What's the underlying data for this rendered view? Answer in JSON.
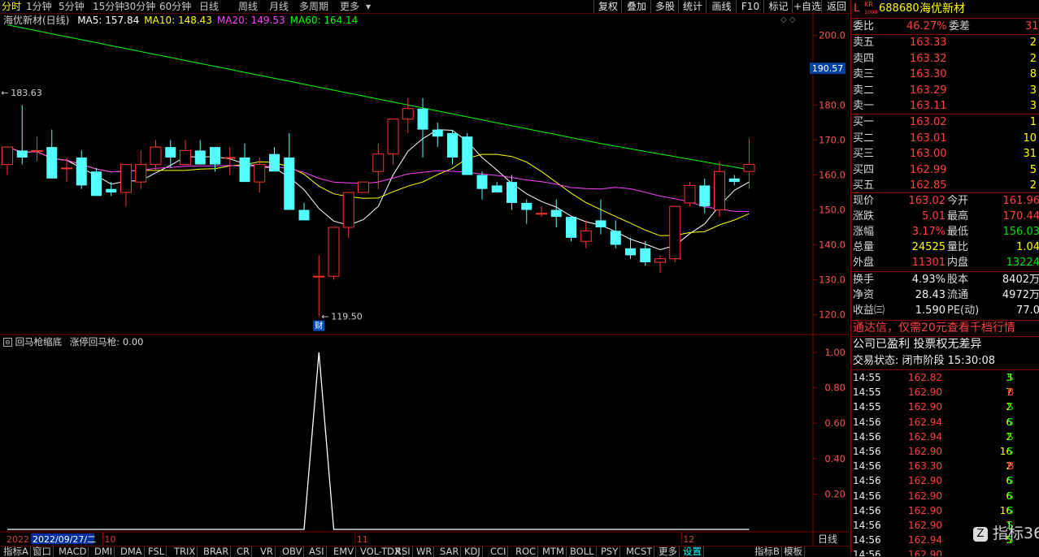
{
  "topbar": {
    "periods": [
      "分时",
      "1分钟",
      "5分钟",
      "15分钟",
      "30分钟",
      "60分钟",
      "日线",
      "周线",
      "月线",
      "多周期",
      "更多"
    ],
    "active_index": 0,
    "tools": [
      "复权",
      "叠加",
      "多股",
      "统计",
      "画线",
      "F10",
      "标记",
      "+自选",
      "返回"
    ]
  },
  "main": {
    "title": "海优新材(日线)",
    "ma_labels": [
      {
        "text": "MA5: 157.84",
        "color": "#ffffff"
      },
      {
        "text": "MA10: 148.43",
        "color": "#ffff00"
      },
      {
        "text": "MA20: 149.53",
        "color": "#ff40ff"
      },
      {
        "text": "MA60: 164.14",
        "color": "#00ff00"
      }
    ],
    "price_axis": [
      "200.0",
      "190.0",
      "180.0",
      "170.0",
      "160.0",
      "150.0",
      "140.0",
      "130.0",
      "120.0"
    ],
    "current_price_tag": "190.57",
    "high_marker": "183.63",
    "low_marker": "119.50",
    "fin_badge": "财"
  },
  "indicator": {
    "title": "回马枪缩底",
    "subtitle": "涨停回马枪: 0.00",
    "axis": [
      "1.00",
      "0.80",
      "0.60",
      "0.40",
      "0.20"
    ]
  },
  "xaxis": {
    "left_date": "2022",
    "cursor_date": "2022/09/27/二",
    "months": [
      "10",
      "11",
      "12"
    ],
    "right_label": "日线"
  },
  "chart_data": {
    "type": "candlestick",
    "ylim": [
      115,
      205
    ],
    "candles": [
      {
        "o": 163,
        "h": 167,
        "l": 160,
        "c": 168
      },
      {
        "o": 167,
        "h": 180,
        "l": 163,
        "c": 165
      },
      {
        "o": 167,
        "h": 171,
        "l": 164,
        "c": 167
      },
      {
        "o": 168,
        "h": 173,
        "l": 161,
        "c": 159
      },
      {
        "o": 162,
        "h": 165,
        "l": 158,
        "c": 162
      },
      {
        "o": 165,
        "h": 167,
        "l": 156,
        "c": 157
      },
      {
        "o": 161,
        "h": 162,
        "l": 155,
        "c": 154
      },
      {
        "o": 156,
        "h": 158,
        "l": 154,
        "c": 155
      },
      {
        "o": 155,
        "h": 162,
        "l": 151,
        "c": 163
      },
      {
        "o": 158,
        "h": 167,
        "l": 156,
        "c": 163
      },
      {
        "o": 163,
        "h": 170,
        "l": 161,
        "c": 168
      },
      {
        "o": 168,
        "h": 170,
        "l": 162,
        "c": 165
      },
      {
        "o": 163,
        "h": 170,
        "l": 163,
        "c": 167
      },
      {
        "o": 167,
        "h": 170,
        "l": 163,
        "c": 163
      },
      {
        "o": 168,
        "h": 168,
        "l": 161,
        "c": 163
      },
      {
        "o": 165,
        "h": 168,
        "l": 160,
        "c": 165
      },
      {
        "o": 165,
        "h": 169,
        "l": 158,
        "c": 158
      },
      {
        "o": 158,
        "h": 165,
        "l": 155,
        "c": 163
      },
      {
        "o": 166,
        "h": 168,
        "l": 161,
        "c": 161
      },
      {
        "o": 165,
        "h": 172,
        "l": 150,
        "c": 150
      },
      {
        "o": 150,
        "h": 152,
        "l": 147,
        "c": 147
      },
      {
        "o": 131,
        "h": 137,
        "l": 119.5,
        "c": 131
      },
      {
        "o": 131,
        "h": 145,
        "l": 130,
        "c": 145
      },
      {
        "o": 145,
        "h": 150,
        "l": 142,
        "c": 155
      },
      {
        "o": 155,
        "h": 158,
        "l": 155,
        "c": 158
      },
      {
        "o": 161,
        "h": 169,
        "l": 156,
        "c": 166
      },
      {
        "o": 166,
        "h": 173,
        "l": 163,
        "c": 176
      },
      {
        "o": 176,
        "h": 182,
        "l": 172,
        "c": 179
      },
      {
        "o": 179,
        "h": 182,
        "l": 165,
        "c": 173
      },
      {
        "o": 173,
        "h": 175,
        "l": 168,
        "c": 171
      },
      {
        "o": 172,
        "h": 173,
        "l": 163,
        "c": 165
      },
      {
        "o": 171,
        "h": 172,
        "l": 160,
        "c": 160
      },
      {
        "o": 160,
        "h": 161,
        "l": 153,
        "c": 156
      },
      {
        "o": 157,
        "h": 158,
        "l": 155,
        "c": 155
      },
      {
        "o": 158,
        "h": 160,
        "l": 150,
        "c": 152
      },
      {
        "o": 152,
        "h": 153,
        "l": 146,
        "c": 150
      },
      {
        "o": 149,
        "h": 151,
        "l": 148,
        "c": 149
      },
      {
        "o": 150,
        "h": 153,
        "l": 145,
        "c": 148
      },
      {
        "o": 148,
        "h": 148,
        "l": 141,
        "c": 142
      },
      {
        "o": 141,
        "h": 147,
        "l": 139,
        "c": 144
      },
      {
        "o": 147,
        "h": 153,
        "l": 143,
        "c": 145
      },
      {
        "o": 144,
        "h": 147,
        "l": 139,
        "c": 140
      },
      {
        "o": 139,
        "h": 142,
        "l": 136,
        "c": 137
      },
      {
        "o": 139,
        "h": 141,
        "l": 134,
        "c": 135
      },
      {
        "o": 135,
        "h": 137,
        "l": 132,
        "c": 136
      },
      {
        "o": 136,
        "h": 151,
        "l": 135,
        "c": 151
      },
      {
        "o": 152,
        "h": 158,
        "l": 151,
        "c": 157
      },
      {
        "o": 157,
        "h": 159,
        "l": 149,
        "c": 151
      },
      {
        "o": 150,
        "h": 164,
        "l": 148,
        "c": 161
      },
      {
        "o": 159,
        "h": 160,
        "l": 157,
        "c": 158
      },
      {
        "o": 161,
        "h": 170.44,
        "l": 156.03,
        "c": 163.02
      }
    ],
    "indicator_values": [
      0,
      0,
      0,
      0,
      0,
      0,
      0,
      0,
      0,
      0,
      0,
      0,
      0,
      0,
      0,
      0,
      0,
      0,
      0,
      0,
      0,
      1,
      0,
      0,
      0,
      0,
      0,
      0,
      0,
      0,
      0,
      0,
      0,
      0,
      0,
      0,
      0,
      0,
      0,
      0,
      0,
      0,
      0,
      0,
      0,
      0,
      0,
      0,
      0,
      0,
      0
    ]
  },
  "quote": {
    "prefix": "L",
    "badge_top": "KR",
    "badge_bot": "1000",
    "code": "688680",
    "name": "海优新材",
    "weibi_label": "委比",
    "weibi_value": "46.27%",
    "weicha_label": "委差",
    "weicha_value": "31",
    "sells": [
      {
        "label": "卖五",
        "price": "163.33",
        "vol": "2"
      },
      {
        "label": "卖四",
        "price": "163.32",
        "vol": "2"
      },
      {
        "label": "卖三",
        "price": "163.30",
        "vol": "8"
      },
      {
        "label": "卖二",
        "price": "163.29",
        "vol": "3"
      },
      {
        "label": "卖一",
        "price": "163.11",
        "vol": "3"
      }
    ],
    "buys": [
      {
        "label": "买一",
        "price": "163.02",
        "vol": "1"
      },
      {
        "label": "买二",
        "price": "163.01",
        "vol": "10"
      },
      {
        "label": "买三",
        "price": "163.00",
        "vol": "31"
      },
      {
        "label": "买四",
        "price": "162.99",
        "vol": "5"
      },
      {
        "label": "买五",
        "price": "162.85",
        "vol": "2"
      }
    ],
    "stats": [
      {
        "l1": "现价",
        "v1": "163.02",
        "c1": "red",
        "l2": "今开",
        "v2": "161.96",
        "c2": "red"
      },
      {
        "l1": "涨跌",
        "v1": "5.01",
        "c1": "red",
        "l2": "最高",
        "v2": "170.44",
        "c2": "red"
      },
      {
        "l1": "涨幅",
        "v1": "3.17%",
        "c1": "red",
        "l2": "最低",
        "v2": "156.03",
        "c2": "green"
      },
      {
        "l1": "总量",
        "v1": "24525",
        "c1": "yel",
        "l2": "量比",
        "v2": "1.04",
        "c2": "yel"
      },
      {
        "l1": "外盘",
        "v1": "11301",
        "c1": "red",
        "l2": "内盘",
        "v2": "13224",
        "c2": "green"
      }
    ],
    "stats2": [
      {
        "l1": "换手",
        "v1": "4.93%",
        "l2": "股本",
        "v2": "8402万"
      },
      {
        "l1": "净资",
        "v1": "28.43",
        "l2": "流通",
        "v2": "4972万"
      },
      {
        "l1": "收益㈢",
        "v1": "1.590",
        "l2": "PE(动)",
        "v2": "77.0"
      }
    ],
    "promo": "通达信，仅需20元查看千档行情",
    "news": "公司已盈利 投票权无差异",
    "status": "交易状态: 闭市阶段 15:30:08",
    "ticks": [
      {
        "t": "14:55",
        "p": "162.82",
        "v": "3",
        "s": "S"
      },
      {
        "t": "14:55",
        "p": "162.90",
        "v": "7",
        "s": "B"
      },
      {
        "t": "14:55",
        "p": "162.90",
        "v": "2",
        "s": "S"
      },
      {
        "t": "14:56",
        "p": "162.94",
        "v": "6",
        "s": "S"
      },
      {
        "t": "14:56",
        "p": "162.94",
        "v": "2",
        "s": "S"
      },
      {
        "t": "14:56",
        "p": "162.90",
        "v": "16",
        "s": "S"
      },
      {
        "t": "14:56",
        "p": "163.30",
        "v": "2",
        "s": "B"
      },
      {
        "t": "14:56",
        "p": "162.90",
        "v": "6",
        "s": "S"
      },
      {
        "t": "14:56",
        "p": "162.90",
        "v": "6",
        "s": "S"
      },
      {
        "t": "14:56",
        "p": "162.90",
        "v": "16",
        "s": "S"
      },
      {
        "t": "14:56",
        "p": "162.90",
        "v": "1",
        "s": "S"
      },
      {
        "t": "14:56",
        "p": "162.94",
        "v": "5",
        "s": "S"
      },
      {
        "t": "14:56",
        "p": "162.90",
        "v": "",
        "s": ""
      }
    ],
    "watermark": "指标365"
  },
  "tabs": [
    "指标A",
    "窗口",
    "MACD",
    "DMI",
    "DMA",
    "FSL",
    "TRIX",
    "BRAR",
    "CR",
    "VR",
    "OBV",
    "ASI",
    "EMV",
    "VOL-TDX",
    "RSI",
    "WR",
    "SAR",
    "KDJ",
    "CCI",
    "ROC",
    "MTM",
    "BOLL",
    "PSY",
    "MCST",
    "更多",
    "设置",
    "指标B",
    "模板"
  ],
  "tabs_selected": "设置"
}
